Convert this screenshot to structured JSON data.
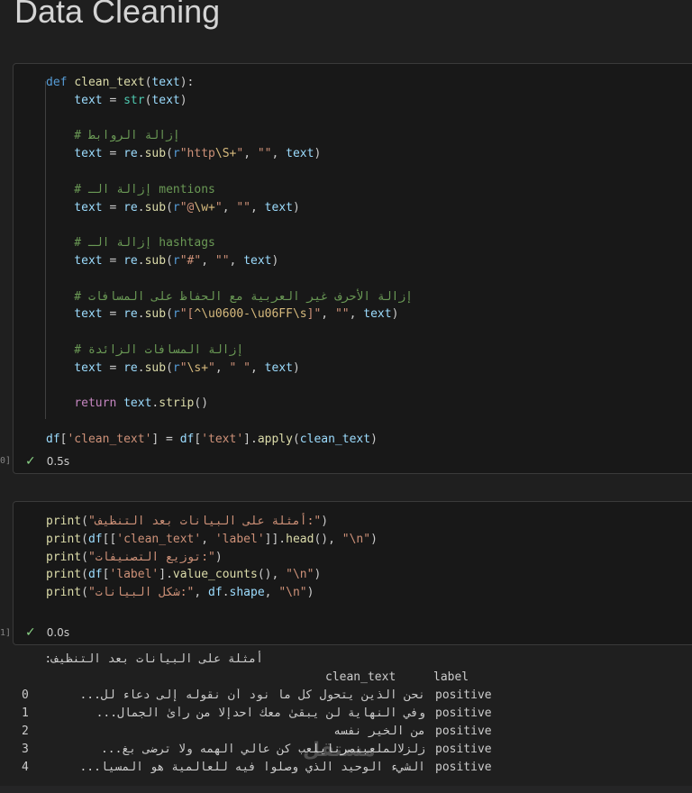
{
  "heading": "Data Cleaning",
  "cell1": {
    "lines": [
      [
        {
          "t": "def ",
          "c": "kw"
        },
        {
          "t": "clean_text",
          "c": "fn"
        },
        {
          "t": "(",
          "c": ""
        },
        {
          "t": "text",
          "c": "var"
        },
        {
          "t": "):",
          "c": ""
        }
      ],
      [
        {
          "t": "    text",
          "c": "var"
        },
        {
          "t": " = ",
          "c": ""
        },
        {
          "t": "str",
          "c": "bi"
        },
        {
          "t": "(",
          "c": ""
        },
        {
          "t": "text",
          "c": "var"
        },
        {
          "t": ")",
          "c": ""
        }
      ],
      [],
      [
        {
          "t": "    # إزالة الروابط",
          "c": "cm"
        }
      ],
      [
        {
          "t": "    text",
          "c": "var"
        },
        {
          "t": " = ",
          "c": ""
        },
        {
          "t": "re",
          "c": "var"
        },
        {
          "t": ".",
          "c": ""
        },
        {
          "t": "sub",
          "c": "fn"
        },
        {
          "t": "(",
          "c": ""
        },
        {
          "t": "r",
          "c": "kw"
        },
        {
          "t": "\"http",
          "c": "str"
        },
        {
          "t": "\\S+",
          "c": "esc"
        },
        {
          "t": "\"",
          "c": "str"
        },
        {
          "t": ", ",
          "c": ""
        },
        {
          "t": "\"\"",
          "c": "str"
        },
        {
          "t": ", ",
          "c": ""
        },
        {
          "t": "text",
          "c": "var"
        },
        {
          "t": ")",
          "c": ""
        }
      ],
      [],
      [
        {
          "t": "    # إزالة الـ mentions",
          "c": "cm"
        }
      ],
      [
        {
          "t": "    text",
          "c": "var"
        },
        {
          "t": " = ",
          "c": ""
        },
        {
          "t": "re",
          "c": "var"
        },
        {
          "t": ".",
          "c": ""
        },
        {
          "t": "sub",
          "c": "fn"
        },
        {
          "t": "(",
          "c": ""
        },
        {
          "t": "r",
          "c": "kw"
        },
        {
          "t": "\"@",
          "c": "str"
        },
        {
          "t": "\\w+",
          "c": "esc"
        },
        {
          "t": "\"",
          "c": "str"
        },
        {
          "t": ", ",
          "c": ""
        },
        {
          "t": "\"\"",
          "c": "str"
        },
        {
          "t": ", ",
          "c": ""
        },
        {
          "t": "text",
          "c": "var"
        },
        {
          "t": ")",
          "c": ""
        }
      ],
      [],
      [
        {
          "t": "    # إزالة الـ hashtags",
          "c": "cm"
        }
      ],
      [
        {
          "t": "    text",
          "c": "var"
        },
        {
          "t": " = ",
          "c": ""
        },
        {
          "t": "re",
          "c": "var"
        },
        {
          "t": ".",
          "c": ""
        },
        {
          "t": "sub",
          "c": "fn"
        },
        {
          "t": "(",
          "c": ""
        },
        {
          "t": "r",
          "c": "kw"
        },
        {
          "t": "\"#\"",
          "c": "str"
        },
        {
          "t": ", ",
          "c": ""
        },
        {
          "t": "\"\"",
          "c": "str"
        },
        {
          "t": ", ",
          "c": ""
        },
        {
          "t": "text",
          "c": "var"
        },
        {
          "t": ")",
          "c": ""
        }
      ],
      [],
      [
        {
          "t": "    # إزالة الأحرف غير العربية مع الحفاظ على المسافات",
          "c": "cm"
        }
      ],
      [
        {
          "t": "    text",
          "c": "var"
        },
        {
          "t": " = ",
          "c": ""
        },
        {
          "t": "re",
          "c": "var"
        },
        {
          "t": ".",
          "c": ""
        },
        {
          "t": "sub",
          "c": "fn"
        },
        {
          "t": "(",
          "c": ""
        },
        {
          "t": "r",
          "c": "kw"
        },
        {
          "t": "\"[",
          "c": "str"
        },
        {
          "t": "^\\u0600-\\u06FF\\s",
          "c": "esc"
        },
        {
          "t": "]\"",
          "c": "str"
        },
        {
          "t": ", ",
          "c": ""
        },
        {
          "t": "\"\"",
          "c": "str"
        },
        {
          "t": ", ",
          "c": ""
        },
        {
          "t": "text",
          "c": "var"
        },
        {
          "t": ")",
          "c": ""
        }
      ],
      [],
      [
        {
          "t": "    # إزالة المسافات الزائدة",
          "c": "cm"
        }
      ],
      [
        {
          "t": "    text",
          "c": "var"
        },
        {
          "t": " = ",
          "c": ""
        },
        {
          "t": "re",
          "c": "var"
        },
        {
          "t": ".",
          "c": ""
        },
        {
          "t": "sub",
          "c": "fn"
        },
        {
          "t": "(",
          "c": ""
        },
        {
          "t": "r",
          "c": "kw"
        },
        {
          "t": "\"",
          "c": "str"
        },
        {
          "t": "\\s+",
          "c": "esc"
        },
        {
          "t": "\"",
          "c": "str"
        },
        {
          "t": ", ",
          "c": ""
        },
        {
          "t": "\" \"",
          "c": "str"
        },
        {
          "t": ", ",
          "c": ""
        },
        {
          "t": "text",
          "c": "var"
        },
        {
          "t": ")",
          "c": ""
        }
      ],
      [],
      [
        {
          "t": "    ",
          "c": ""
        },
        {
          "t": "return ",
          "c": "ctl"
        },
        {
          "t": "text",
          "c": "var"
        },
        {
          "t": ".",
          "c": ""
        },
        {
          "t": "strip",
          "c": "fn"
        },
        {
          "t": "()",
          "c": ""
        }
      ],
      [],
      [
        {
          "t": "df",
          "c": "var"
        },
        {
          "t": "[",
          "c": ""
        },
        {
          "t": "'clean_text'",
          "c": "str"
        },
        {
          "t": "] = ",
          "c": ""
        },
        {
          "t": "df",
          "c": "var"
        },
        {
          "t": "[",
          "c": ""
        },
        {
          "t": "'text'",
          "c": "str"
        },
        {
          "t": "].",
          "c": ""
        },
        {
          "t": "apply",
          "c": "fn"
        },
        {
          "t": "(",
          "c": ""
        },
        {
          "t": "clean_text",
          "c": "var"
        },
        {
          "t": ")",
          "c": ""
        }
      ]
    ],
    "status_time": "0.5s",
    "exec_marker": "0]"
  },
  "cell2": {
    "lines": [
      [
        {
          "t": "print",
          "c": "fn"
        },
        {
          "t": "(",
          "c": ""
        },
        {
          "t": "\"أمثلة على البيانات بعد التنظيف:\"",
          "c": "str"
        },
        {
          "t": ")",
          "c": ""
        }
      ],
      [
        {
          "t": "print",
          "c": "fn"
        },
        {
          "t": "(",
          "c": ""
        },
        {
          "t": "df",
          "c": "var"
        },
        {
          "t": "[[",
          "c": ""
        },
        {
          "t": "'clean_text'",
          "c": "str"
        },
        {
          "t": ", ",
          "c": ""
        },
        {
          "t": "'label'",
          "c": "str"
        },
        {
          "t": "]].",
          "c": ""
        },
        {
          "t": "head",
          "c": "fn"
        },
        {
          "t": "(), ",
          "c": ""
        },
        {
          "t": "\"\\n\"",
          "c": "str"
        },
        {
          "t": ")",
          "c": ""
        }
      ],
      [
        {
          "t": "print",
          "c": "fn"
        },
        {
          "t": "(",
          "c": ""
        },
        {
          "t": "\"توزيع التصنيفات:\"",
          "c": "str"
        },
        {
          "t": ")",
          "c": ""
        }
      ],
      [
        {
          "t": "print",
          "c": "fn"
        },
        {
          "t": "(",
          "c": ""
        },
        {
          "t": "df",
          "c": "var"
        },
        {
          "t": "[",
          "c": ""
        },
        {
          "t": "'label'",
          "c": "str"
        },
        {
          "t": "].",
          "c": ""
        },
        {
          "t": "value_counts",
          "c": "fn"
        },
        {
          "t": "(), ",
          "c": ""
        },
        {
          "t": "\"\\n\"",
          "c": "str"
        },
        {
          "t": ")",
          "c": ""
        }
      ],
      [
        {
          "t": "print",
          "c": "fn"
        },
        {
          "t": "(",
          "c": ""
        },
        {
          "t": "\"شكل البيانات:\"",
          "c": "str"
        },
        {
          "t": ", ",
          "c": ""
        },
        {
          "t": "df",
          "c": "var"
        },
        {
          "t": ".",
          "c": ""
        },
        {
          "t": "shape",
          "c": "var"
        },
        {
          "t": ", ",
          "c": ""
        },
        {
          "t": "\"\\n\"",
          "c": "str"
        },
        {
          "t": ")",
          "c": ""
        }
      ]
    ],
    "status_time": "0.0s",
    "exec_marker": "1]"
  },
  "output": {
    "heading": "أمثلة على البيانات بعد التنظيف:",
    "col_clean_text": "clean_text",
    "col_label": "label",
    "rows": [
      {
        "idx": "0",
        "text": "نحن الذين يتحول كل ما نود أن نقوله إلى دعاء لل...",
        "label": "positive"
      },
      {
        "idx": "1",
        "text": "وفي النهاية لن يبقىٰ معك آحدإلا من رأىٰ الجمال...",
        "label": "positive"
      },
      {
        "idx": "2",
        "text": "من الخير نفسه",
        "label": "positive"
      },
      {
        "idx": "3",
        "text": "زلزلالملعبنصرنايلعب كن عالي الهمه ولا ترضى بغ...",
        "label": "positive"
      },
      {
        "idx": "4",
        "text": "الشيء الوحيد الذي وصلوا فيه للعالمية هو المسيا...",
        "label": "positive"
      }
    ]
  },
  "watermark": "مستقل"
}
